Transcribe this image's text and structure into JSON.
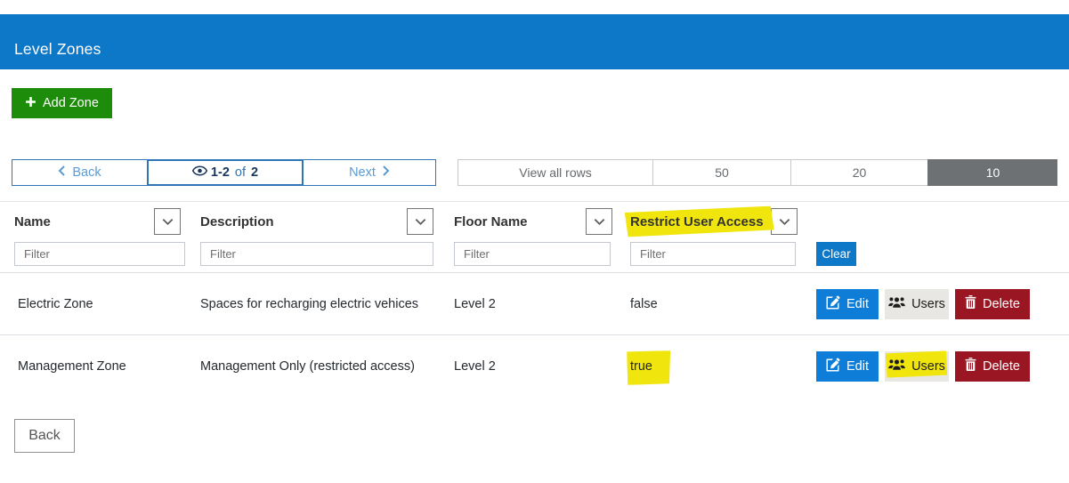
{
  "page": {
    "title": "Level Zones"
  },
  "toolbar": {
    "add_zone_label": "Add Zone"
  },
  "pagination": {
    "back_label": "Back",
    "next_label": "Next",
    "range": "1-2",
    "of_label": "of",
    "total": "2",
    "sizes": [
      "View all rows",
      "50",
      "20",
      "10"
    ],
    "selected_size": "10"
  },
  "table": {
    "columns": [
      {
        "label": "Name",
        "highlighted": false
      },
      {
        "label": "Description",
        "highlighted": false
      },
      {
        "label": "Floor Name",
        "highlighted": false
      },
      {
        "label": "Restrict User Access",
        "highlighted": true
      }
    ],
    "filter_placeholder": "Filter",
    "clear_label": "Clear",
    "actions": {
      "edit": "Edit",
      "users": "Users",
      "delete": "Delete"
    },
    "rows": [
      {
        "name": "Electric Zone",
        "description": "Spaces for recharging electric vehices",
        "floor_name": "Level 2",
        "restrict_user_access": "false",
        "restrict_highlighted": false,
        "users_button_highlighted": false
      },
      {
        "name": "Management Zone",
        "description": "Management Only (restricted access)",
        "floor_name": "Level 2",
        "restrict_user_access": "true",
        "restrict_highlighted": true,
        "users_button_highlighted": true
      }
    ]
  },
  "footer": {
    "back_label": "Back"
  },
  "colors": {
    "header_blue": "#0d78c8",
    "add_green": "#1e8c0b",
    "pager_border_blue": "#2e75b6",
    "pager_text_blue": "#5b9bd5",
    "selected_size_gray": "#6d7174",
    "edit_blue": "#0d7dd8",
    "users_gray": "#e9e7e4",
    "delete_red": "#9a1622",
    "highlight_yellow": "#f1e50e",
    "clear_blue": "#0e78c8"
  }
}
